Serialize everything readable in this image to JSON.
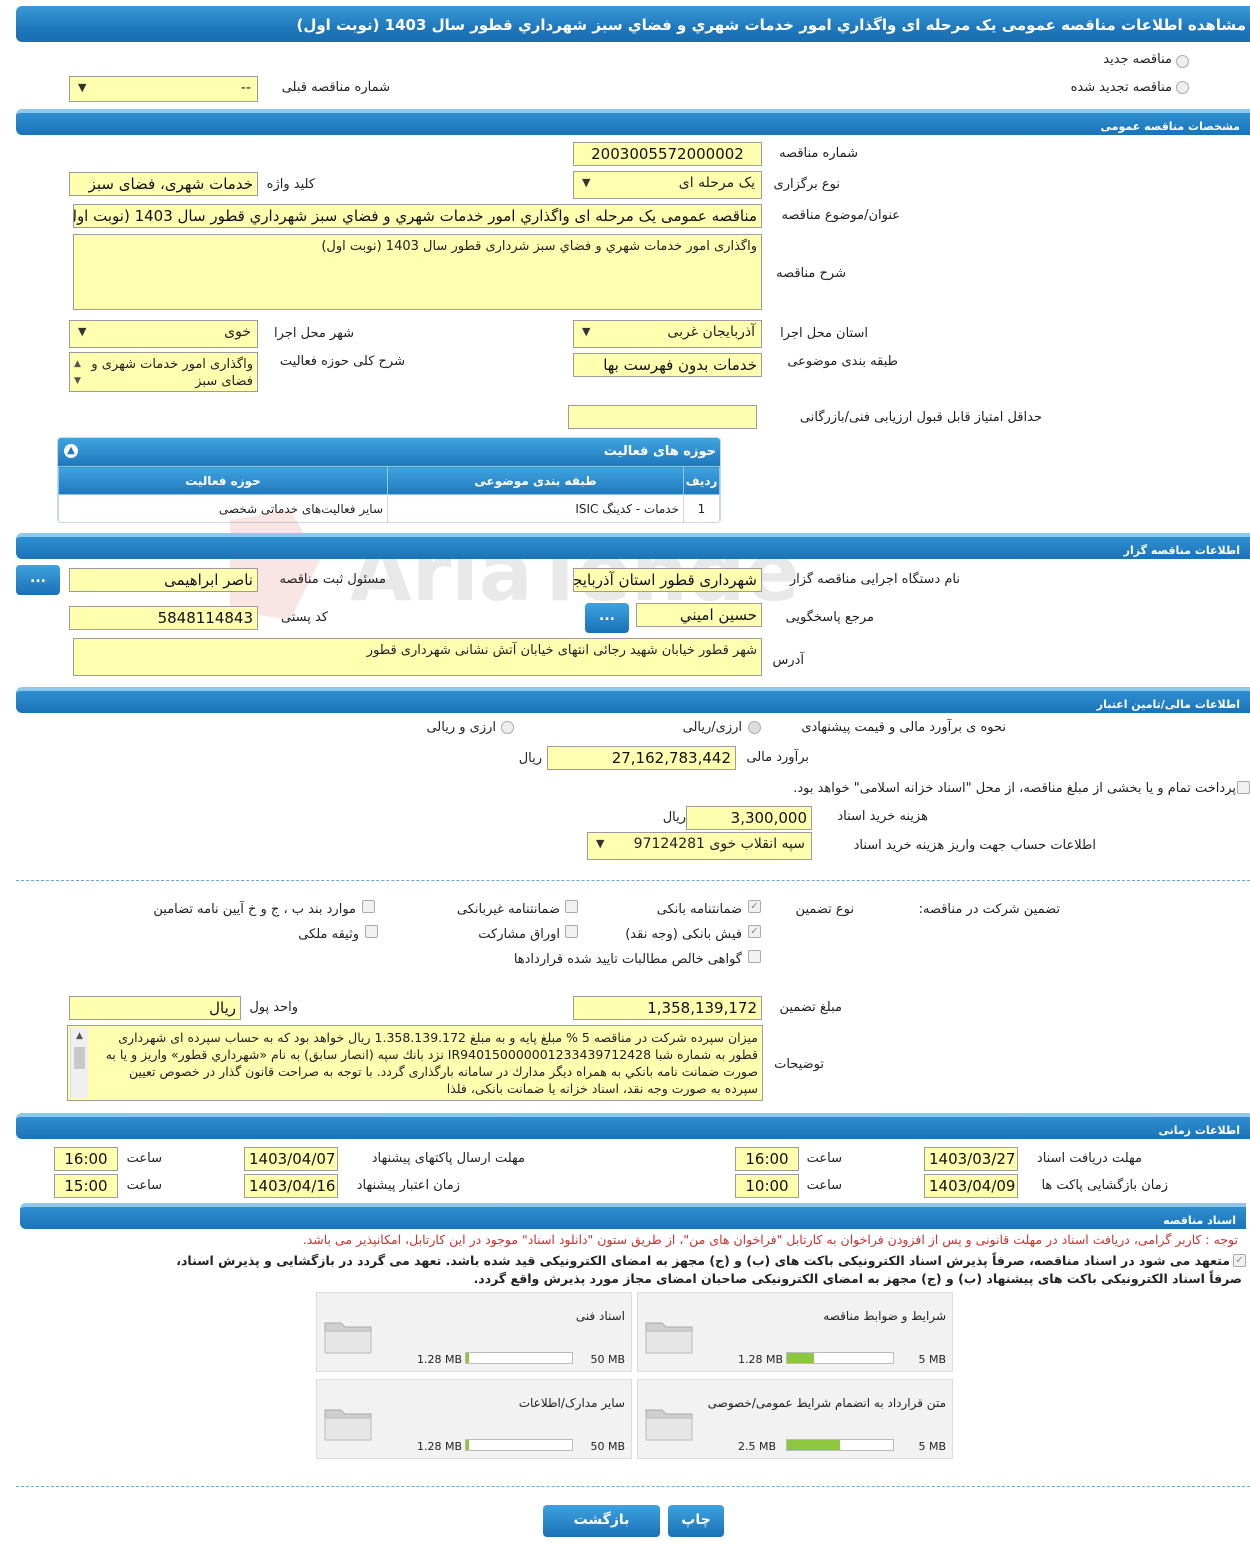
{
  "title": "مشاهده اطلاعات مناقصه عمومی یک مرحله ای واگذاري امور خدمات شهري و فضاي سبز شهرداري قطور سال 1403 (نوبت اول)",
  "radio": {
    "new": "مناقصه جدید",
    "renewed": "مناقصه تجدید شده"
  },
  "prev": {
    "label": "شماره مناقصه قبلی",
    "value": "--"
  },
  "general": {
    "header": "مشخصات مناقصه عمومی",
    "number_label": "شماره مناقصه",
    "number": "2003005572000002",
    "type_label": "نوع برگزاری",
    "type": "یک مرحله ای",
    "keyword_label": "کلید واژه",
    "keyword": "خدمات شهری، فضای سبز",
    "subject_label": "عنوان/موضوع مناقصه",
    "subject": "مناقصه عمومی یک مرحله ای واگذاري امور خدمات شهري و فضاي سبز شهرداري قطور سال 1403 (نوبت اول)",
    "desc_label": "شرح مناقصه",
    "desc": "واگذاری امور خدمات شهري و فضاي سبز شرداری قطور سال 1403 (نوبت اول)",
    "province_label": "استان محل اجرا",
    "province": "آذربایجان غربی",
    "city_label": "شهر محل اجرا",
    "city": "خوی",
    "category_label": "طبقه بندی موضوعی",
    "category": "خدمات بدون فهرست بها",
    "scope_label": "شرح کلی حوزه فعالیت",
    "scope": "واگذاری امور خدمات شهری و فضای سبز",
    "minscore_label": "حداقل امتیاز قابل قبول ارزیابی فنی/بازرگانی",
    "minscore": ""
  },
  "activity": {
    "header": "حوزه های فعالیت",
    "cols": [
      "ردیف",
      "طبقه بندی موضوعی",
      "حوزه فعالیت"
    ],
    "rows": [
      [
        "1",
        "خدمات - کدینگ ISIC",
        "سایر فعالیت‌های خدماتی شخصی"
      ]
    ]
  },
  "organizer": {
    "header": "اطلاعات مناقصه گزار",
    "org_label": "نام دستگاه اجرایی مناقصه گزار",
    "org": "شهرداری قطور استان آذربایجان غربی",
    "resp_label": "مسئول ثبت مناقصه",
    "resp": "ناصر ابراهیمی",
    "ref_label": "مرجع پاسخگویی",
    "ref": "حسين اميني",
    "postal_label": "کد پستی",
    "postal": "5848114843",
    "addr_label": "آدرس",
    "addr": "شهر قطور خیابان شهید رجائی انتهای خیابان آتش نشانی شهرداری قطور",
    "dots": "..."
  },
  "finance": {
    "header": "اطلاعات مالی/تامین اعتبار",
    "method_label": "نحوه ی برآورد مالی و قیمت پیشنهادی",
    "opt1": "ارزی/ریالی",
    "opt2": "ارزی و ریالی",
    "estimate_label": "برآورد مالی",
    "estimate": "27,162,783,442",
    "rial": "ریال",
    "treasury": "پرداخت تمام و یا بخشی از مبلغ مناقصه، از محل \"اسناد خزانه اسلامی\" خواهد بود.",
    "docfee_label": "هزینه خرید اسناد",
    "docfee": "3,300,000",
    "account_label": "اطلاعات حساب جهت واریز هزینه خرید اسناد",
    "account": "سپه انقلاب خوی 97124281"
  },
  "guarantee": {
    "label": "تضمین شرکت در مناقصه:",
    "type_label": "نوع تضمین",
    "opts": [
      "ضمانتنامه بانکی",
      "ضمانتنامه غیربانکی",
      "موارد بند ب ، ج و خ آیین نامه تضامین",
      "فیش بانکی (وجه نقد)",
      "اوراق مشارکت",
      "وثیقه ملکی",
      "گواهی خالص مطالبات تایید شده قراردادها"
    ],
    "amount_label": "مبلغ تضمین",
    "amount": "1,358,139,172",
    "unit_label": "واحد پول",
    "unit": "ریال",
    "notes_label": "توضیحات",
    "notes": "میزان سپرده شرکت در مناقصه 5 % مبلغ پایه و به مبلغ 1.358.139.172 ریال خواهد بود که به حساب سپرده ای شهرداری قطور به شماره شبا IR940150000001233439712428 نزد بانك سپه (انصار سابق) به نام «شهرداري قطور» واريز و يا به صورت ضمانت نامه بانكي به همراه ديگر مدارك در سامانه بارگذاری گردد. با توجه به صراحت قانون گذار در خصوص تعیین سپرده به صورت وجه نقد، اسناد خزانه یا ضمانت بانکی، فلذا"
  },
  "timing": {
    "header": "اطلاعات زمانی",
    "recv_label": "مهلت دریافت اسناد",
    "recv_date": "1403/03/27",
    "recv_time": "16:00",
    "send_label": "مهلت ارسال پاکتهای پیشنهاد",
    "send_date": "1403/04/07",
    "send_time": "16:00",
    "open_label": "زمان بازگشایی پاکت ها",
    "open_date": "1403/04/09",
    "open_time": "10:00",
    "valid_label": "زمان اعتبار پیشنهاد",
    "valid_date": "1403/04/16",
    "valid_time": "15:00",
    "time_label": "ساعت"
  },
  "docs": {
    "header": "اسناد مناقصه",
    "notice": "توجه : کاربر گرامی، دریافت اسناد در مهلت قانونی و پس از افزودن فراخوان به کارتابل \"فراخوان های من\"، از طریق ستون \"دانلود اسناد\" موجود در این کارتابل، امکانپذیر می باشد.",
    "commit1": "متعهد می شود در اسناد مناقصه، صرفاً پذیرش اسناد الکترونیکی باکت های (ب) و (ج) مجهز به امضای الکترونیکی قید شده باشد. تعهد می گردد در بازگشایی و پذیرش اسناد،",
    "commit2": "صرفاً اسناد الکترونیکی باکت های پیشنهاد (ب) و (ج) مجهز به امضای الکترونیکی صاحبان امضای مجاز مورد پذیرش واقع گردد.",
    "files": [
      {
        "name": "شرایط و ضوابط مناقصه",
        "size": "1.28 MB",
        "max": "5 MB",
        "ratio": 0.256
      },
      {
        "name": "اسناد فنی",
        "size": "1.28 MB",
        "max": "50 MB",
        "ratio": 0.026
      },
      {
        "name": "متن قرارداد به انضمام شرایط عمومی/خصوصی",
        "size": "2.5 MB",
        "max": "5 MB",
        "ratio": 0.5
      },
      {
        "name": "سایر مدارک/اطلاعات",
        "size": "1.28 MB",
        "max": "50 MB",
        "ratio": 0.026
      }
    ]
  },
  "buttons": {
    "print": "چاپ",
    "back": "بازگشت"
  },
  "watermark": "AriaTender.neT"
}
